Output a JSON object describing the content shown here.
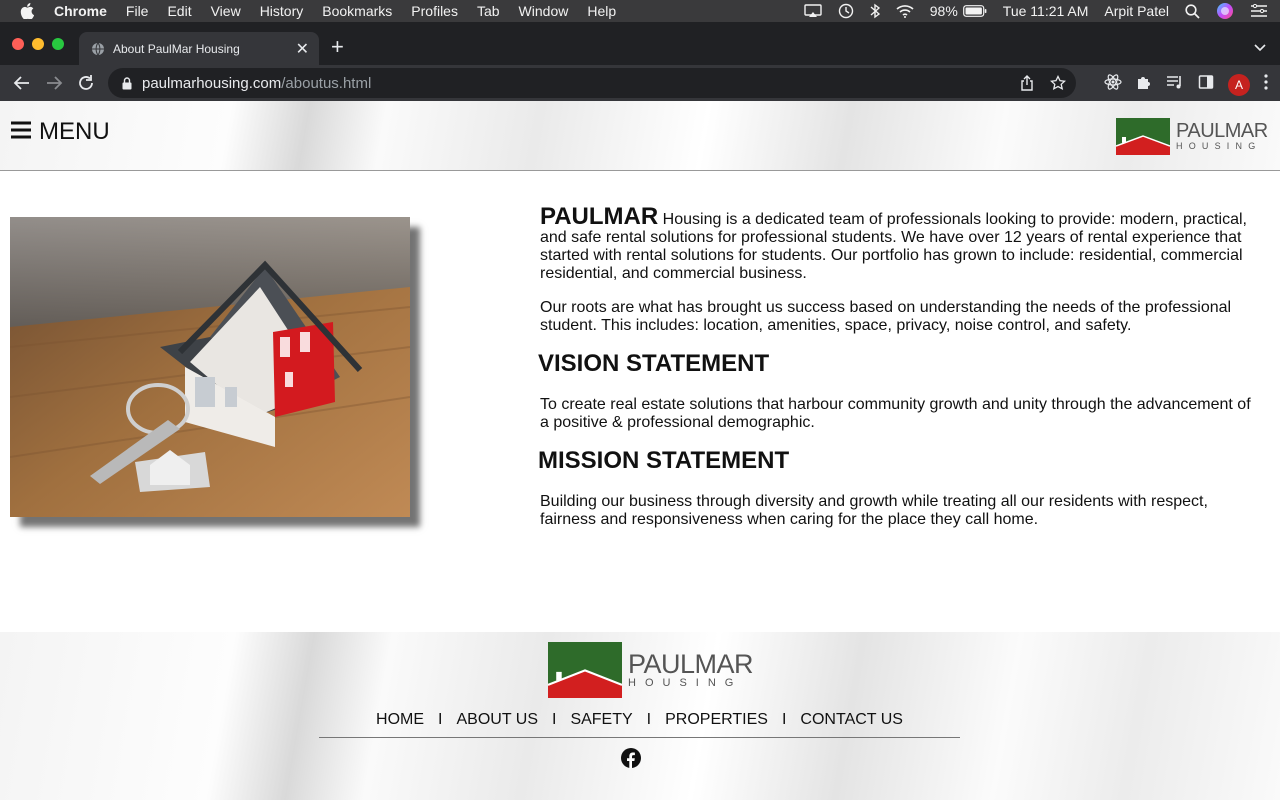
{
  "menubar": {
    "app": "Chrome",
    "items": [
      "File",
      "Edit",
      "View",
      "History",
      "Bookmarks",
      "Profiles",
      "Tab",
      "Window",
      "Help"
    ],
    "battery": "98%",
    "clock": "Tue 11:21 AM",
    "user": "Arpit Patel"
  },
  "browser": {
    "tab_title": "About PaulMar Housing",
    "url_host": "paulmarhousing.com",
    "url_path": "/aboutus.html",
    "profile_initial": "A"
  },
  "header": {
    "menu_label": "MENU",
    "logo_word": "PAULMAR",
    "logo_sub": "HOUSING"
  },
  "about": {
    "brand": "PAULMAR",
    "intro": " Housing is a dedicated team of professionals looking to provide: modern, practical, and safe rental solutions for professional students. We have over 12 years of rental experience that started with rental solutions for students. Our portfolio has grown to include: residential, commercial residential, and commercial business.",
    "roots": "Our roots are what has brought us success based on understanding the needs of the professional student. This includes: location, amenities, space, privacy, noise control, and safety.",
    "vision_heading": "VISION STATEMENT",
    "vision_text": "To create real estate solutions that harbour community growth and unity through the advancement of a positive & professional demographic.",
    "mission_heading": "MISSION STATEMENT",
    "mission_text": "Building our business through diversity and growth while treating all our residents with respect, fairness and responsiveness when caring for the place they call home."
  },
  "footer": {
    "logo_word": "PAULMAR",
    "logo_sub": "HOUSING",
    "nav": [
      "HOME",
      "ABOUT US",
      "SAFETY",
      "PROPERTIES",
      "CONTACT US"
    ],
    "separator": "I"
  },
  "colors": {
    "logo_green": "#2e6b2a",
    "logo_red": "#d21f1f",
    "house_red": "#c8161d"
  },
  "icons": {
    "header_menu": "hamburger-icon",
    "footer_social": "facebook-icon"
  }
}
